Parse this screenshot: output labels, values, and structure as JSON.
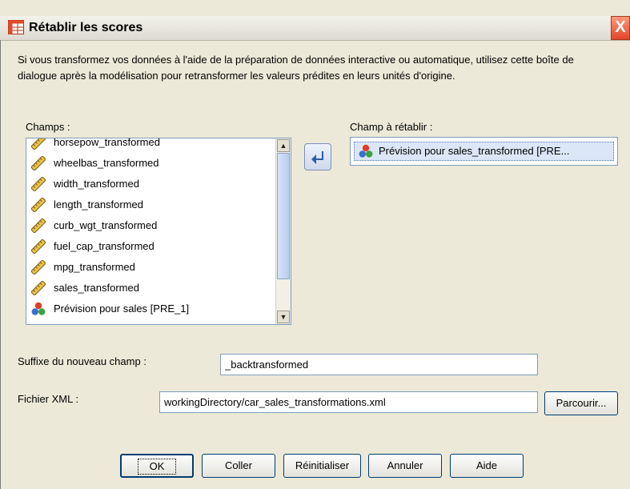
{
  "window": {
    "title": "Rétablir les scores",
    "close_label": "X"
  },
  "description": "Si vous transformez vos données à l'aide de la préparation de données interactive ou automatique, utilisez cette boîte de dialogue après la modélisation pour retransformer les valeurs prédites en leurs unités d'origine.",
  "fields": {
    "label": "Champs :",
    "items": [
      {
        "label": "horsepow_transformed",
        "icon": "ruler-icon"
      },
      {
        "label": "wheelbas_transformed",
        "icon": "ruler-icon"
      },
      {
        "label": "width_transformed",
        "icon": "ruler-icon"
      },
      {
        "label": "length_transformed",
        "icon": "ruler-icon"
      },
      {
        "label": "curb_wgt_transformed",
        "icon": "ruler-icon"
      },
      {
        "label": "fuel_cap_transformed",
        "icon": "ruler-icon"
      },
      {
        "label": "mpg_transformed",
        "icon": "ruler-icon"
      },
      {
        "label": "sales_transformed",
        "icon": "ruler-icon"
      },
      {
        "label": "Prévision pour sales [PRE_1]",
        "icon": "nominal-set-icon"
      }
    ]
  },
  "target": {
    "label": "Champ à rétablir :",
    "value": "Prévision pour sales_transformed [PRE..."
  },
  "suffix": {
    "label": "Suffixe du nouveau champ :",
    "value": "_backtransformed"
  },
  "xml": {
    "label": "Fichier XML :",
    "value": "workingDirectory/car_sales_transformations.xml",
    "browse_label": "Parcourir..."
  },
  "buttons": {
    "ok": "OK",
    "paste": "Coller",
    "reset": "Réinitialiser",
    "cancel": "Annuler",
    "help": "Aide"
  },
  "colors": {
    "title_bar": "#ecebe3",
    "close_button": "#e2452a",
    "selection": "#dbe6f6",
    "dialog_bg": "#ece9d8"
  }
}
